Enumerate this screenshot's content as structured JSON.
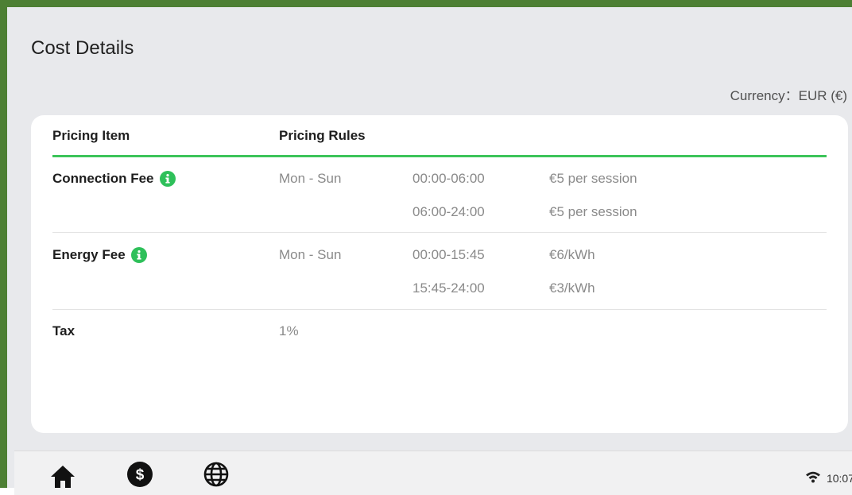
{
  "page": {
    "title": "Cost Details",
    "currency": "Currency：EUR (€)"
  },
  "table": {
    "headers": {
      "item": "Pricing Item",
      "rules": "Pricing Rules"
    },
    "rows": [
      {
        "item": "Connection Fee",
        "has_info": true,
        "days": "Mon - Sun",
        "periods": [
          {
            "time": "00:00-06:00",
            "price": "€5 per session"
          },
          {
            "time": "06:00-24:00",
            "price": "€5 per session"
          }
        ]
      },
      {
        "item": "Energy Fee",
        "has_info": true,
        "days": "Mon - Sun",
        "periods": [
          {
            "time": "00:00-15:45",
            "price": "€6/kWh"
          },
          {
            "time": "15:45-24:00",
            "price": "€3/kWh"
          }
        ]
      },
      {
        "item": "Tax",
        "has_info": false,
        "value": "1%"
      }
    ]
  },
  "footer": {
    "nav": [
      {
        "icon": "home-icon"
      },
      {
        "icon": "dollar-icon"
      },
      {
        "icon": "globe-icon"
      }
    ],
    "status": {
      "wifi_icon": "wifi-icon",
      "time": "10:07"
    }
  },
  "colors": {
    "frame_border": "#4d7f34",
    "accent": "#3cc45a",
    "info_icon": "#2ec05a"
  }
}
